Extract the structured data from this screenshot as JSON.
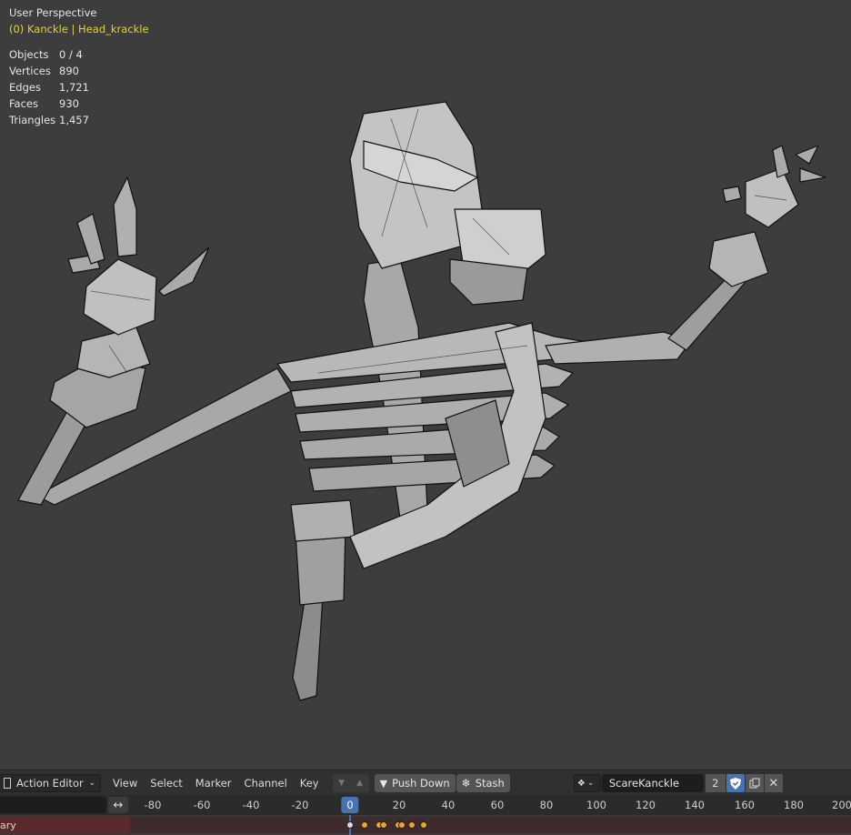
{
  "viewport": {
    "perspective_label": "User Perspective",
    "selection_label": "(0) Kanckle | Head_krackle",
    "stats": [
      {
        "label": "Objects",
        "value": "0 / 4"
      },
      {
        "label": "Vertices",
        "value": "890"
      },
      {
        "label": "Edges",
        "value": "1,721"
      },
      {
        "label": "Faces",
        "value": "930"
      },
      {
        "label": "Triangles",
        "value": "1,457"
      }
    ]
  },
  "editor_header": {
    "editor_type": "Action Editor",
    "menus": [
      "View",
      "Select",
      "Marker",
      "Channel",
      "Key"
    ],
    "push_down_label": "Push Down",
    "stash_label": "Stash",
    "action_name": "ScareKanckle",
    "user_count": "2"
  },
  "timeline": {
    "ticks": [
      "-80",
      "-60",
      "-40",
      "-20",
      "0",
      "20",
      "40",
      "60",
      "80",
      "100",
      "120",
      "140",
      "160",
      "180",
      "200"
    ],
    "current_frame": "0",
    "channel_label": "ary"
  },
  "colors": {
    "accent": "#4772b3",
    "keyframe": "#f0a420",
    "selection_text": "#e6d040"
  }
}
